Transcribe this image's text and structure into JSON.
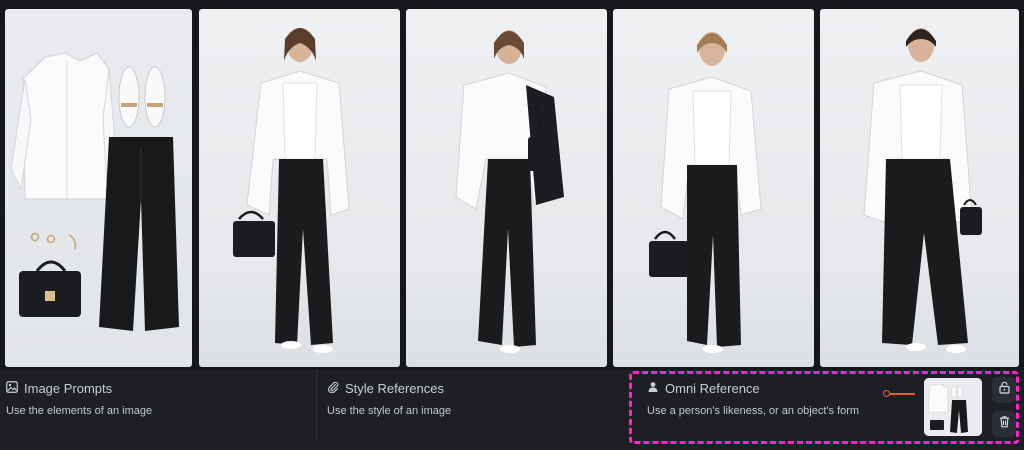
{
  "gallery": {
    "images": [
      {
        "name": "flatlay-outfit-image"
      },
      {
        "name": "model-image-1"
      },
      {
        "name": "model-image-2"
      },
      {
        "name": "model-image-3"
      },
      {
        "name": "model-image-4"
      }
    ]
  },
  "panel": {
    "image_prompts": {
      "title": "Image Prompts",
      "description": "Use the elements of an image",
      "icon": "image-icon"
    },
    "style_references": {
      "title": "Style References",
      "description": "Use the style of an image",
      "icon": "paperclip-icon"
    },
    "omni_reference": {
      "title": "Omni Reference",
      "description": "Use a person's likeness, or an object's form",
      "icon": "person-icon"
    }
  },
  "colors": {
    "background": "#16171b",
    "panel": "#1d1f25",
    "highlight": "#ff23c8",
    "slider": "#e85a2c"
  },
  "icons": {
    "lock": "unlock-icon",
    "delete": "trash-icon"
  }
}
